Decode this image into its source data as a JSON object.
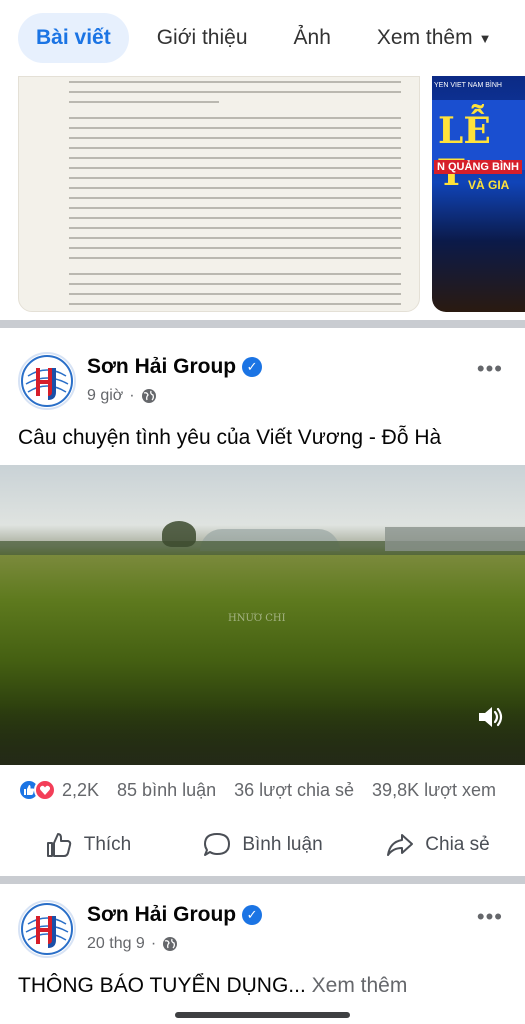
{
  "tabs": [
    {
      "label": "Bài viết",
      "active": true
    },
    {
      "label": "Giới thiệu",
      "active": false
    },
    {
      "label": "Ảnh",
      "active": false
    },
    {
      "label": "Xem thêm",
      "active": false
    }
  ],
  "photo_strip": {
    "event_banner": {
      "top_text": "YEN VIET NAM BÌNH",
      "big_text": "LỄ T",
      "line1": "N QUẢNG BÌNH",
      "line2": "VÀ GIA"
    }
  },
  "post1": {
    "author": "Sơn Hải Group",
    "time": "9 giờ",
    "text": "Câu chuyện tình yêu của Viết Vương - Đỗ Hà",
    "video_watermark": "HNƯƠ CHI",
    "reaction_count": "2,2K",
    "comments": "85 bình luận",
    "shares": "36 lượt chia sẻ",
    "views": "39,8K lượt xem",
    "actions": {
      "like": "Thích",
      "comment": "Bình luận",
      "share": "Chia sẻ"
    }
  },
  "post2": {
    "author": "Sơn Hải Group",
    "time": "20 thg 9",
    "text": "THÔNG BÁO TUYỂN DỤNG...",
    "see_more": "Xem thêm"
  },
  "colors": {
    "accent": "#1b74e4",
    "love": "#f33e58",
    "tab_active_bg": "#e7f0fd"
  },
  "icons": [
    "chevron-down-icon",
    "verified-icon",
    "globe-icon",
    "more-icon",
    "volume-icon",
    "like-icon",
    "love-icon",
    "comment-icon",
    "share-icon"
  ]
}
